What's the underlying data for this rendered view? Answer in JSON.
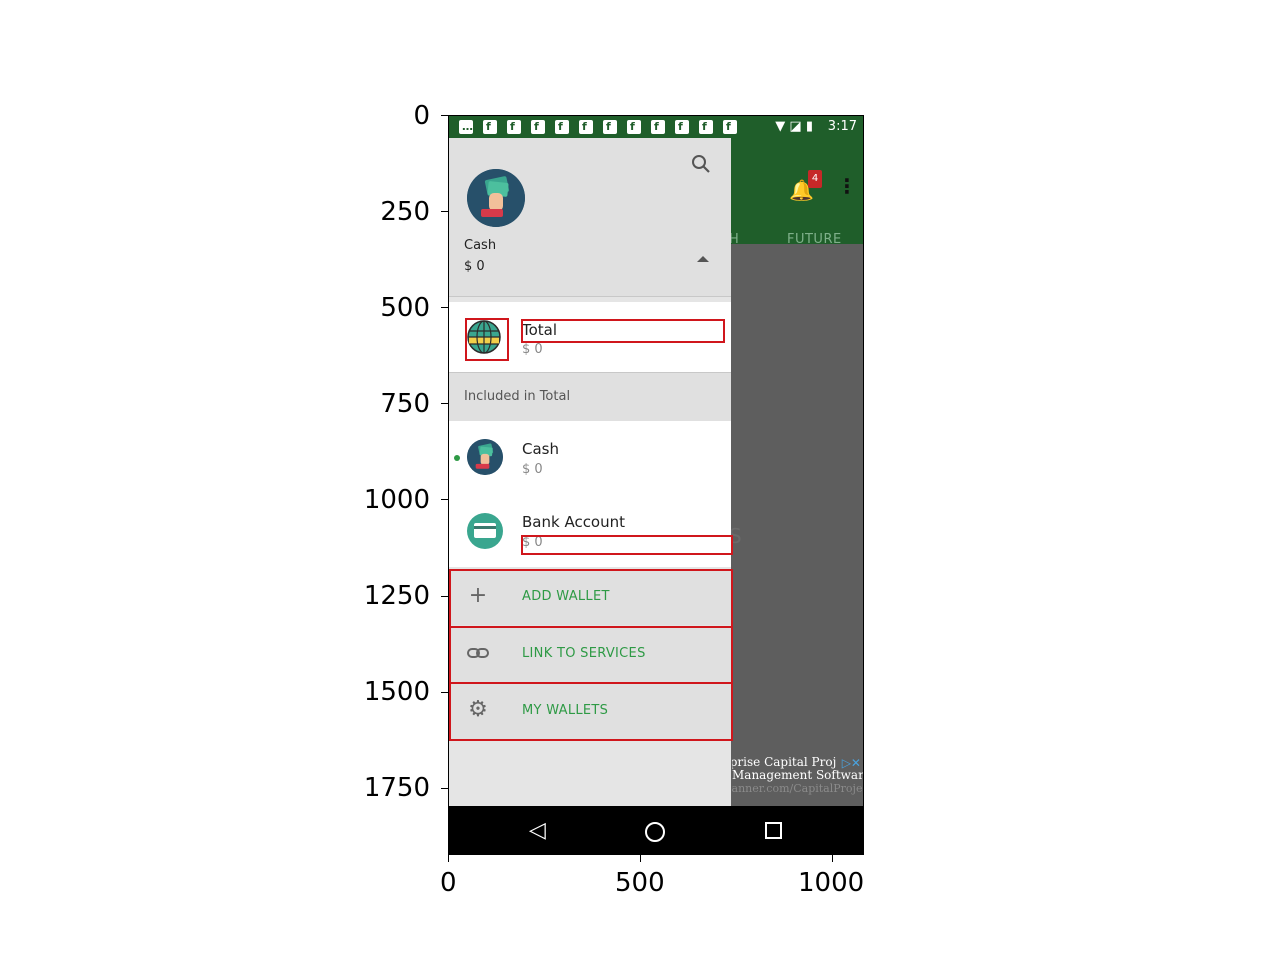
{
  "axes": {
    "y_ticks": [
      "0",
      "250",
      "500",
      "750",
      "1000",
      "1250",
      "1500",
      "1750"
    ],
    "x_ticks": [
      "0",
      "500",
      "1000"
    ]
  },
  "status_bar": {
    "time": "3:17",
    "notification_icon": "facebook-icon",
    "notification_count": 11
  },
  "background_app": {
    "tab_partial": "H",
    "tab_future": "FUTURE",
    "notification_badge": "4",
    "partial_letter": "S",
    "ad": {
      "line1": "rprise Capital Proj",
      "line2": "Management Software",
      "line3": "lanner.com/CapitalProject"
    }
  },
  "drawer": {
    "header": {
      "wallet_name": "Cash",
      "balance": "$ 0"
    },
    "total": {
      "name": "Total",
      "balance": "$ 0"
    },
    "section_title": "Included in Total",
    "wallets": [
      {
        "name": "Cash",
        "balance": "$ 0",
        "icon": "cash-wallet-icon",
        "active": true
      },
      {
        "name": "Bank Account",
        "balance": "$ 0",
        "icon": "bank-card-icon",
        "active": false
      }
    ],
    "actions": [
      {
        "label": "ADD WALLET",
        "icon": "plus-icon"
      },
      {
        "label": "LINK TO SERVICES",
        "icon": "link-icon"
      },
      {
        "label": "MY WALLETS",
        "icon": "gear-icon"
      }
    ]
  },
  "colors": {
    "accent_green": "#2e9a45",
    "app_bar": "#1f5e2a",
    "highlight_red": "#d0161c"
  }
}
